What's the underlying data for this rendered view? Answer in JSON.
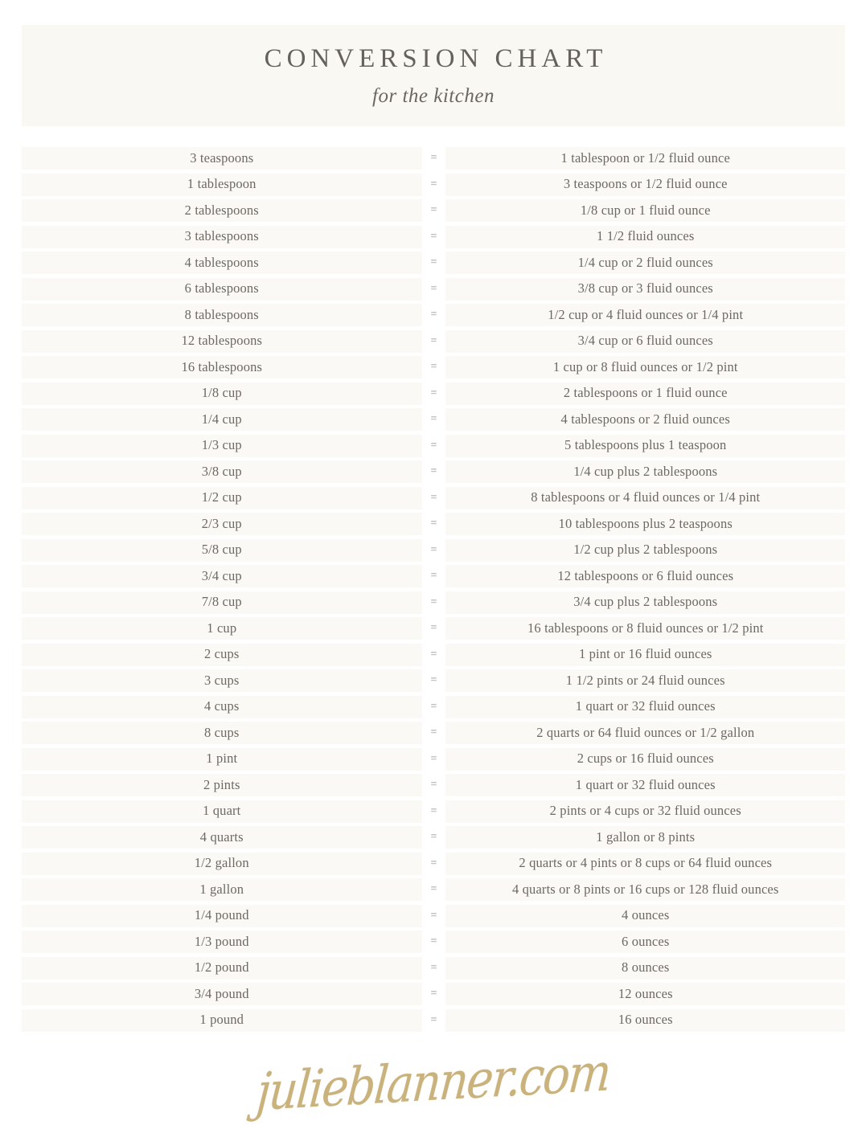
{
  "header": {
    "title": "CONVERSION CHART",
    "subtitle": "for the kitchen"
  },
  "table": {
    "equals_symbol": "=",
    "rows": [
      {
        "from": "3 teaspoons",
        "to": "1 tablespoon or 1/2 fluid ounce"
      },
      {
        "from": "1 tablespoon",
        "to": "3 teaspoons or 1/2 fluid ounce"
      },
      {
        "from": "2 tablespoons",
        "to": "1/8 cup or 1 fluid ounce"
      },
      {
        "from": "3 tablespoons",
        "to": "1 1/2 fluid ounces"
      },
      {
        "from": "4 tablespoons",
        "to": "1/4 cup or 2 fluid ounces"
      },
      {
        "from": "6 tablespoons",
        "to": "3/8 cup or 3 fluid ounces"
      },
      {
        "from": "8 tablespoons",
        "to": "1/2 cup or 4 fluid ounces or 1/4 pint"
      },
      {
        "from": "12 tablespoons",
        "to": "3/4 cup or 6 fluid ounces"
      },
      {
        "from": "16 tablespoons",
        "to": "1 cup or 8 fluid ounces or 1/2 pint"
      },
      {
        "from": "1/8 cup",
        "to": "2 tablespoons or 1 fluid ounce"
      },
      {
        "from": "1/4 cup",
        "to": "4 tablespoons or 2 fluid ounces"
      },
      {
        "from": "1/3 cup",
        "to": "5 tablespoons plus 1 teaspoon"
      },
      {
        "from": "3/8 cup",
        "to": "1/4 cup plus 2 tablespoons"
      },
      {
        "from": "1/2 cup",
        "to": "8 tablespoons or 4 fluid ounces or 1/4 pint"
      },
      {
        "from": "2/3 cup",
        "to": "10 tablespoons plus 2 teaspoons"
      },
      {
        "from": "5/8 cup",
        "to": "1/2 cup plus 2 tablespoons"
      },
      {
        "from": "3/4 cup",
        "to": "12 tablespoons or 6 fluid ounces"
      },
      {
        "from": "7/8 cup",
        "to": "3/4 cup plus 2 tablespoons"
      },
      {
        "from": "1 cup",
        "to": "16 tablespoons or 8 fluid ounces or 1/2 pint"
      },
      {
        "from": "2 cups",
        "to": "1 pint or 16 fluid ounces"
      },
      {
        "from": "3 cups",
        "to": "1 1/2 pints or 24 fluid ounces"
      },
      {
        "from": "4 cups",
        "to": "1 quart or 32 fluid ounces"
      },
      {
        "from": "8 cups",
        "to": "2 quarts or 64 fluid ounces or 1/2 gallon"
      },
      {
        "from": "1 pint",
        "to": "2 cups or 16 fluid ounces"
      },
      {
        "from": "2 pints",
        "to": "1 quart or 32 fluid ounces"
      },
      {
        "from": "1 quart",
        "to": "2 pints or 4 cups or 32 fluid ounces"
      },
      {
        "from": "4 quarts",
        "to": "1 gallon or 8 pints"
      },
      {
        "from": "1/2 gallon",
        "to": "2 quarts or 4 pints or 8 cups or 64 fluid ounces"
      },
      {
        "from": "1 gallon",
        "to": "4 quarts or 8 pints or 16 cups or 128 fluid ounces"
      },
      {
        "from": "1/4 pound",
        "to": "4 ounces"
      },
      {
        "from": "1/3 pound",
        "to": "6 ounces"
      },
      {
        "from": "1/2 pound",
        "to": "8 ounces"
      },
      {
        "from": "3/4 pound",
        "to": "12 ounces"
      },
      {
        "from": "1 pound",
        "to": "16 ounces"
      }
    ]
  },
  "footer": {
    "brand": "julieblanner.com"
  },
  "colors": {
    "page_background": "#ffffff",
    "header_band": "#faf8f3",
    "row_background": "#faf9f5",
    "text": "#6d6862",
    "title_text": "#65625e",
    "equals_text": "#8c8882",
    "brand_gold": "#c6ac72"
  }
}
